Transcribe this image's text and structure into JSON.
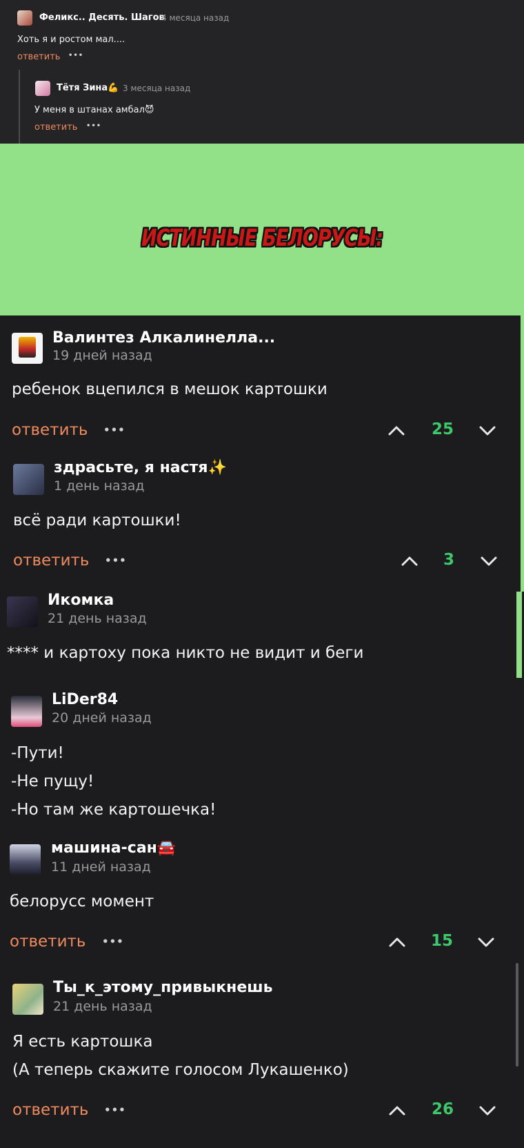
{
  "thread_top": [
    {
      "author": "Феликс.. Десять. Шагов",
      "time": "4 месяца назад",
      "text": "Хоть я и ростом мал....",
      "reply": "ответить",
      "more": "•••"
    },
    {
      "author": "Тётя Зина💪",
      "time": "3 месяца назад",
      "text": "У меня в штанах амбал😈",
      "reply": "ответить",
      "more": "•••"
    }
  ],
  "banner": {
    "text": "ИСТИННЫЕ БЕЛОРУСЫ:",
    "bg": "#92e189",
    "text_color": "#c91818"
  },
  "comments": [
    {
      "author": "Валинтез Алкалинелла...",
      "time": "19 дней назад",
      "lines": [
        "ребенок вцепился в мешок картошки"
      ],
      "reply": "ответить",
      "more": "•••",
      "votes": "25"
    },
    {
      "author": "здрасьте, я настя✨",
      "time": "1 день назад",
      "lines": [
        "всё ради картошки!"
      ],
      "reply": "ответить",
      "more": "•••",
      "votes": "3"
    },
    {
      "author": "Икомка",
      "time": "21 день назад",
      "lines": [
        "**** и картоху пока никто не видит и беги"
      ]
    },
    {
      "author": "LiDer84",
      "time": "20 дней назад",
      "lines": [
        "-Пути!",
        "-Не пущу!",
        "-Но там же картошечка!"
      ]
    },
    {
      "author": "машина-сан🚘",
      "time": "11 дней назад",
      "lines": [
        "белорусс момент"
      ],
      "reply": "ответить",
      "more": "•••",
      "votes": "15"
    },
    {
      "author": "Ты_к_этому_привыкнешь",
      "time": "21 день назад",
      "lines": [
        "Я есть картошка",
        "(А теперь скажите голосом Лукашенко)"
      ],
      "reply": "ответить",
      "more": "•••",
      "votes": "26"
    }
  ],
  "colors": {
    "reply": "#ef8a5f",
    "votes": "#3fc76c",
    "background": "#1c1c1e",
    "thread_bg": "#242326"
  },
  "icons": {
    "upvote": "chevron-up-icon",
    "downvote": "chevron-down-icon"
  }
}
